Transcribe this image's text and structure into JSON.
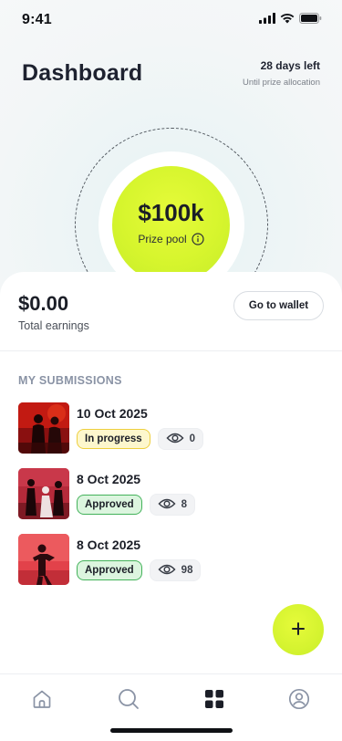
{
  "status_bar": {
    "time": "9:41",
    "icons": [
      "cellular-signal-icon",
      "wifi-icon",
      "battery-icon"
    ]
  },
  "header": {
    "title": "Dashboard",
    "countdown_main": "28 days left",
    "countdown_sub": "Until prize allocation"
  },
  "prize": {
    "amount": "$100k",
    "label": "Prize pool",
    "icon": "info-icon"
  },
  "earnings": {
    "amount": "$0.00",
    "label": "Total earnings",
    "wallet_button_label": "Go to wallet"
  },
  "submissions": {
    "section_title": "MY SUBMISSIONS",
    "items": [
      {
        "date": "10 Oct 2025",
        "status": "In progress",
        "views": "0"
      },
      {
        "date": "8 Oct 2025",
        "status": "Approved",
        "views": "8"
      },
      {
        "date": "8 Oct 2025",
        "status": "Approved",
        "views": "98"
      }
    ]
  },
  "fab": {
    "icon": "plus-icon"
  },
  "bottom_nav": {
    "items": [
      "home-icon",
      "search-icon",
      "grid-icon",
      "profile-icon"
    ],
    "active": "grid-icon"
  },
  "colors": {
    "accent": "#d6f52d",
    "background": "#f3f6f7",
    "text_dark": "#1e2230",
    "badge_progress_bg": "#fdf7cd",
    "badge_progress_border": "#eecf3f",
    "badge_approved_bg": "#dcf5df",
    "badge_approved_border": "#43b25a"
  }
}
